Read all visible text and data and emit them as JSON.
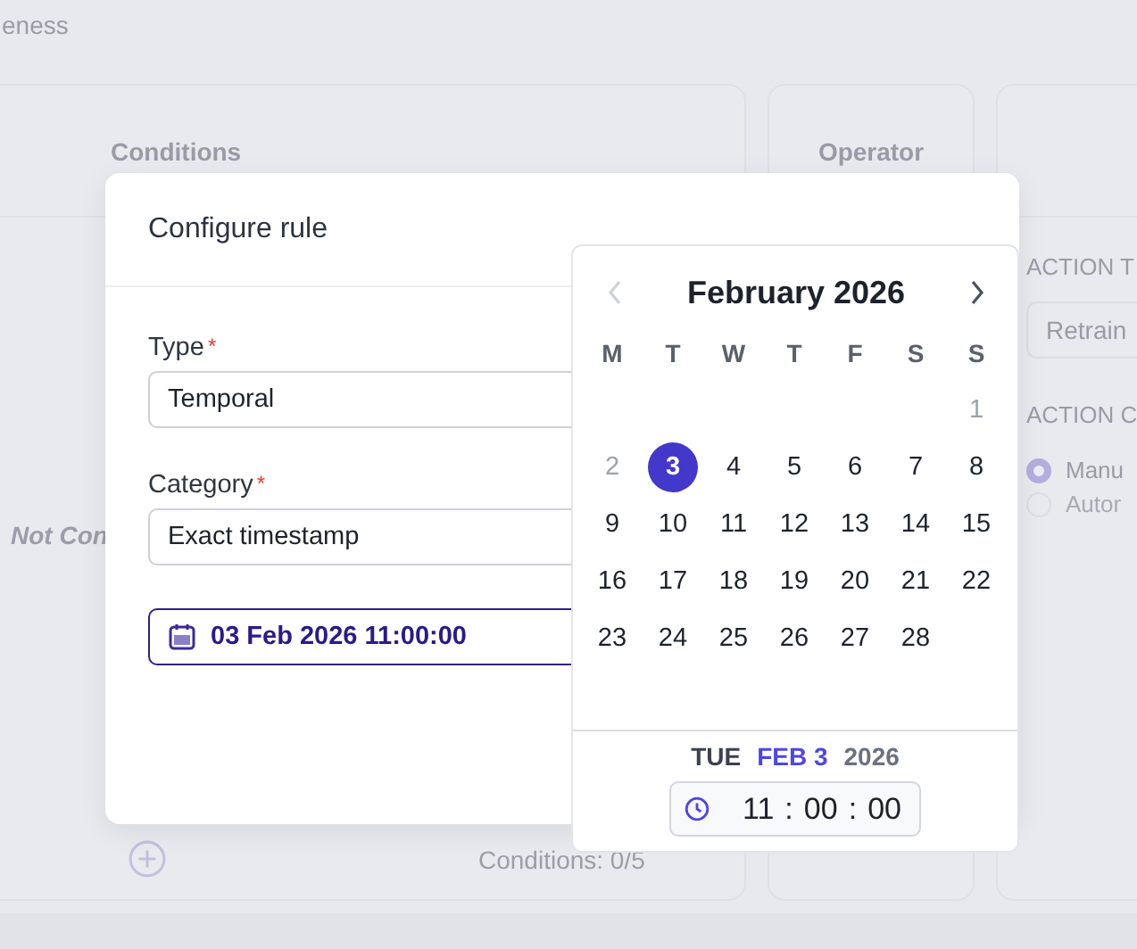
{
  "background": {
    "heading_fragment": "eness",
    "conditions_card": {
      "title": "Conditions",
      "empty_text": "Not Con",
      "counter": "Conditions: 0/5"
    },
    "operator_card": {
      "title": "Operator"
    },
    "action_card": {
      "type_label": "ACTION T",
      "type_value": "Retrain",
      "mode_label": "ACTION C",
      "modes": [
        {
          "label": "Manu",
          "selected": true
        },
        {
          "label": "Autor",
          "selected": false
        }
      ]
    }
  },
  "dialog": {
    "title": "Configure rule",
    "fields": [
      {
        "label": "Type",
        "required_mark": "*",
        "value": "Temporal"
      },
      {
        "label": "Category",
        "required_mark": "*",
        "value": "Exact timestamp"
      }
    ],
    "date_field": {
      "value": "03 Feb 2026 11:00:00"
    }
  },
  "date_picker": {
    "month": "February 2026",
    "prev_disabled": true,
    "next_disabled": false,
    "weekdays": [
      "M",
      "T",
      "W",
      "T",
      "F",
      "S",
      "S"
    ],
    "weeks": [
      {
        "days": [
          {
            "kind": "empty"
          },
          {
            "kind": "empty"
          },
          {
            "kind": "empty"
          },
          {
            "kind": "empty"
          },
          {
            "kind": "empty"
          },
          {
            "kind": "empty"
          },
          {
            "kind": "day",
            "label": "1",
            "disabled": true,
            "selected": false
          }
        ]
      },
      {
        "days": [
          {
            "kind": "day",
            "label": "2",
            "disabled": true,
            "selected": false
          },
          {
            "kind": "day",
            "label": "3",
            "disabled": false,
            "selected": true
          },
          {
            "kind": "day",
            "label": "4",
            "disabled": false,
            "selected": false
          },
          {
            "kind": "day",
            "label": "5",
            "disabled": false,
            "selected": false
          },
          {
            "kind": "day",
            "label": "6",
            "disabled": false,
            "selected": false
          },
          {
            "kind": "day",
            "label": "7",
            "disabled": false,
            "selected": false
          },
          {
            "kind": "day",
            "label": "8",
            "disabled": false,
            "selected": false
          }
        ]
      },
      {
        "days": [
          {
            "kind": "day",
            "label": "9",
            "disabled": false,
            "selected": false
          },
          {
            "kind": "day",
            "label": "10",
            "disabled": false,
            "selected": false
          },
          {
            "kind": "day",
            "label": "11",
            "disabled": false,
            "selected": false
          },
          {
            "kind": "day",
            "label": "12",
            "disabled": false,
            "selected": false
          },
          {
            "kind": "day",
            "label": "13",
            "disabled": false,
            "selected": false
          },
          {
            "kind": "day",
            "label": "14",
            "disabled": false,
            "selected": false
          },
          {
            "kind": "day",
            "label": "15",
            "disabled": false,
            "selected": false
          }
        ]
      },
      {
        "days": [
          {
            "kind": "day",
            "label": "16",
            "disabled": false,
            "selected": false
          },
          {
            "kind": "day",
            "label": "17",
            "disabled": false,
            "selected": false
          },
          {
            "kind": "day",
            "label": "18",
            "disabled": false,
            "selected": false
          },
          {
            "kind": "day",
            "label": "19",
            "disabled": false,
            "selected": false
          },
          {
            "kind": "day",
            "label": "20",
            "disabled": false,
            "selected": false
          },
          {
            "kind": "day",
            "label": "21",
            "disabled": false,
            "selected": false
          },
          {
            "kind": "day",
            "label": "22",
            "disabled": false,
            "selected": false
          }
        ]
      },
      {
        "days": [
          {
            "kind": "day",
            "label": "23",
            "disabled": false,
            "selected": false
          },
          {
            "kind": "day",
            "label": "24",
            "disabled": false,
            "selected": false
          },
          {
            "kind": "day",
            "label": "25",
            "disabled": false,
            "selected": false
          },
          {
            "kind": "day",
            "label": "26",
            "disabled": false,
            "selected": false
          },
          {
            "kind": "day",
            "label": "27",
            "disabled": false,
            "selected": false
          },
          {
            "kind": "day",
            "label": "28",
            "disabled": false,
            "selected": false
          },
          {
            "kind": "empty"
          }
        ]
      }
    ],
    "footer": {
      "weekday": "TUE",
      "date": "FEB 3",
      "year": "2026"
    },
    "time": {
      "hours": "11",
      "minutes": "00",
      "seconds": "00",
      "separators": [
        ":",
        ":"
      ]
    }
  }
}
